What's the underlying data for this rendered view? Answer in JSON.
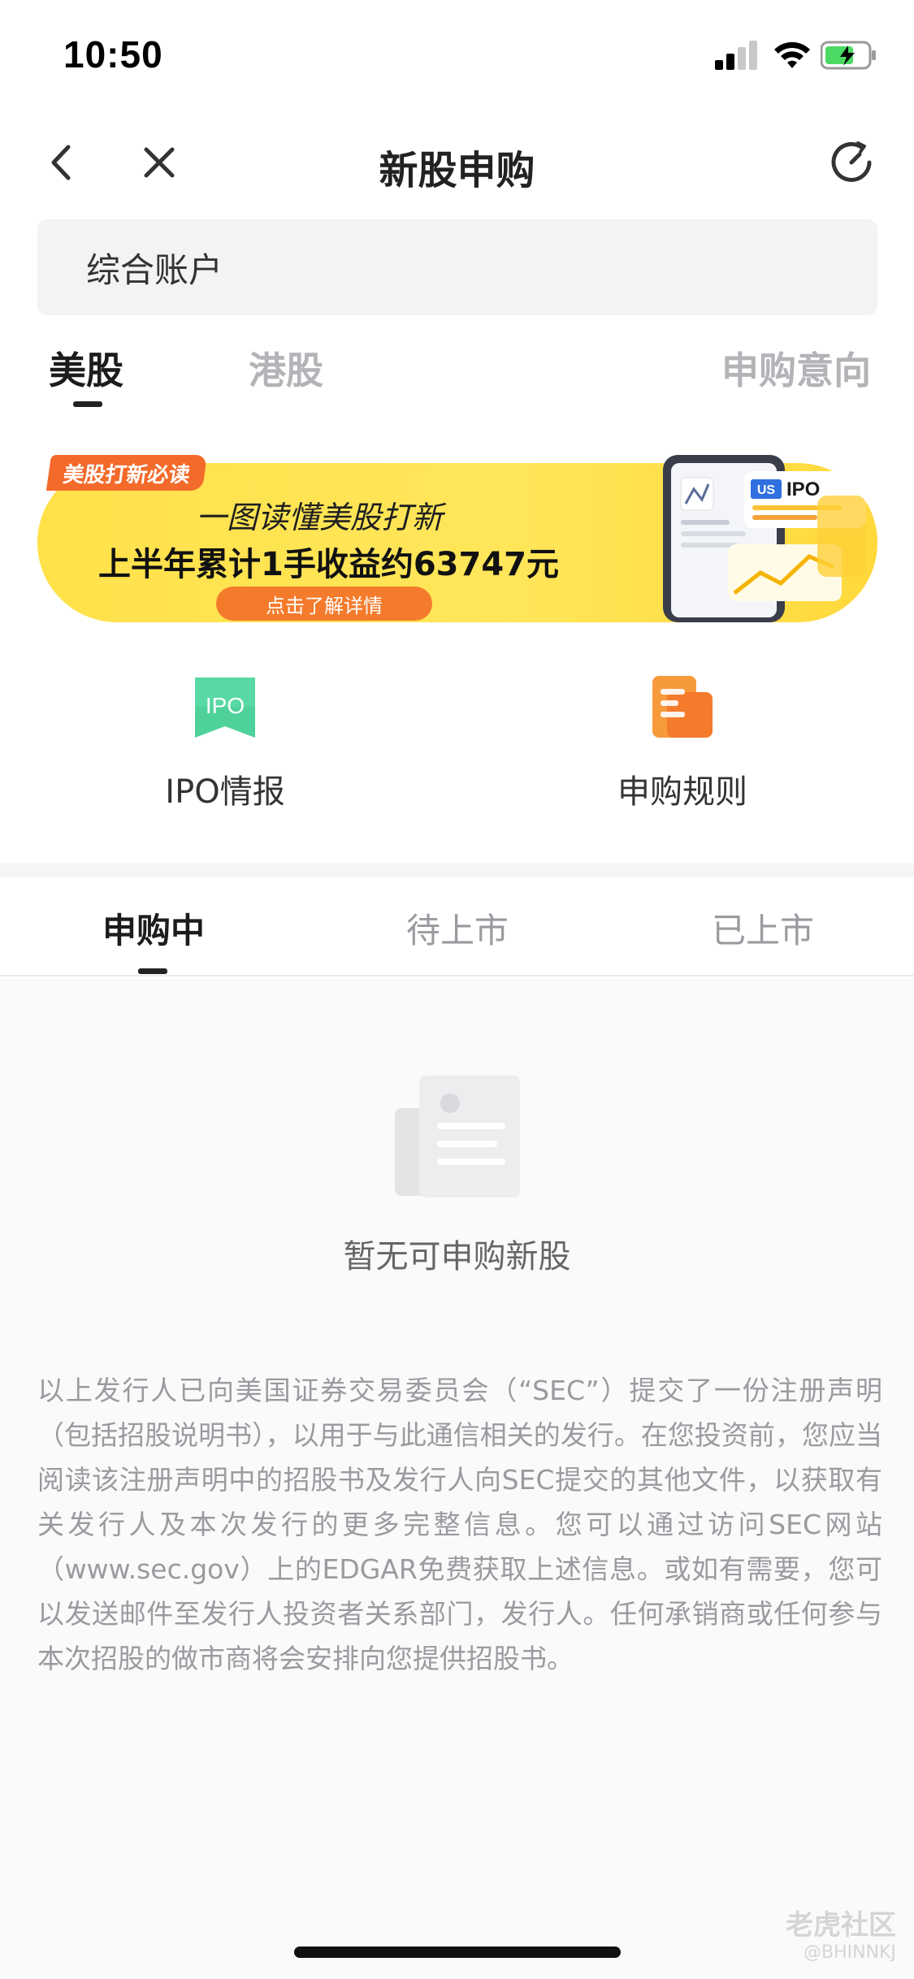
{
  "status_bar": {
    "time": "10:50"
  },
  "nav": {
    "title": "新股申购",
    "back_icon": "chevron-left-icon",
    "close_icon": "close-icon",
    "history_icon": "refresh-clock-icon"
  },
  "account": {
    "label": "综合账户"
  },
  "market_tabs": [
    {
      "label": "美股",
      "active": true
    },
    {
      "label": "港股",
      "active": false
    }
  ],
  "intent_link": "申购意向",
  "banner": {
    "tag": "美股打新必读",
    "line1": "一图读懂美股打新",
    "line2": "上半年累计1手收益约63747元",
    "cta": "点击了解详情",
    "art_badge": "US IPO"
  },
  "features": [
    {
      "label": "IPO情报",
      "icon": "ipo-icon",
      "icon_text": "IPO",
      "color": "#4fd29a"
    },
    {
      "label": "申购规则",
      "icon": "rules-document-icon",
      "color": "#f57b2c"
    }
  ],
  "status_tabs": [
    {
      "label": "申购中",
      "active": true
    },
    {
      "label": "待上市",
      "active": false
    },
    {
      "label": "已上市",
      "active": false
    }
  ],
  "empty_state": {
    "text": "暂无可申购新股",
    "icon": "empty-document-icon"
  },
  "disclaimer": "以上发行人已向美国证券交易委员会（“SEC”）提交了一份注册声明（包括招股说明书），以用于与此通信相关的发行。在您投资前，您应当阅读该注册声明中的招股书及发行人向SEC提交的其他文件，以获取有关发行人及本次发行的更多完整信息。您可以通过访问SEC网站（www.sec.gov）上的EDGAR免费获取上述信息。或如有需要，您可以发送邮件至发行人投资者关系部门，发行人。任何承销商或任何参与本次招股的做市商将会安排向您提供招股书。",
  "watermark": {
    "brand": "老虎社区",
    "handle": "@BHINNKJ"
  },
  "colors": {
    "accent_orange": "#f57b2c",
    "banner_yellow": "#ffe14a",
    "ipo_green": "#4fd29a"
  }
}
